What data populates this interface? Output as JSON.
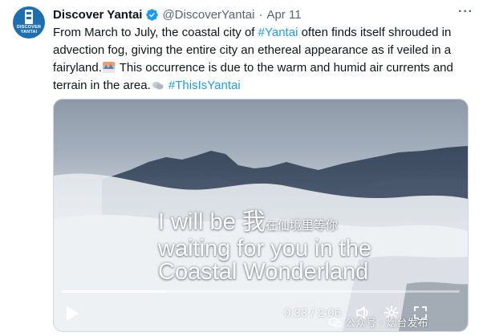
{
  "tweet": {
    "author_name": "Discover Yantai",
    "handle": "@DiscoverYantai",
    "separator": "·",
    "date": "Apr 11",
    "more_label": "···",
    "avatar_text": "DISCOVER YANTAI",
    "text_part1": "From March to July, the coastal city of ",
    "link1": "#Yantai",
    "text_part2": " often finds itself shrouded in advection fog, giving the entire city an ethereal appearance as if veiled in a fairyland.",
    "text_part3": " This occurrence is due to the warm and humid air currents and terrain in the area.",
    "hashtag2": "#ThisIsYantai"
  },
  "video": {
    "subtitle_line1_en": "I will be ",
    "subtitle_line1_zh_big": "我",
    "subtitle_line1_zh_small": "在仙境里等你",
    "subtitle_line2": "waiting for you in the",
    "subtitle_line3": "Coastal Wonderland",
    "current_time": "0:33",
    "time_separator": " / ",
    "duration": "2:06",
    "progress_fraction": 0.262
  },
  "watermark": {
    "text": "公众号 · 烟台发布"
  },
  "colors": {
    "link": "#1d9bf0",
    "verified": "#1d9bf0",
    "secondary_text": "#536471"
  }
}
